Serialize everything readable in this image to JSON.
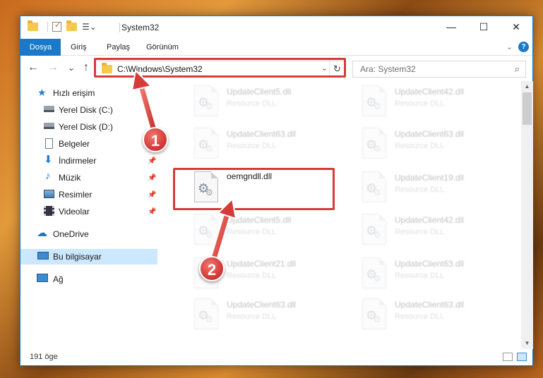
{
  "window": {
    "title": "System32",
    "minimize_glyph": "—",
    "maximize_glyph": "☐",
    "close_glyph": "✕"
  },
  "ribbon": {
    "tabs": [
      "Dosya",
      "Giriş",
      "Paylaş",
      "Görünüm"
    ],
    "help_glyph": "?",
    "accent_color": "#1979ca"
  },
  "nav": {
    "back_glyph": "←",
    "forward_glyph": "→",
    "recent_glyph": "⌄",
    "up_glyph": "↑",
    "address_path": "C:\\Windows\\System32",
    "dropdown_glyph": "⌄",
    "refresh_glyph": "↻",
    "search_placeholder": "Ara: System32",
    "search_icon": "search-icon"
  },
  "sidebar": {
    "items": [
      {
        "label": "Hızlı erişim",
        "icon": "star-icon",
        "pinned": false
      },
      {
        "label": "Yerel Disk (C:)",
        "icon": "drive-icon",
        "pinned": false
      },
      {
        "label": "Yerel Disk (D:)",
        "icon": "drive-icon",
        "pinned": false
      },
      {
        "label": "Belgeler",
        "icon": "documents-icon",
        "pinned": false
      },
      {
        "label": "İndirmeler",
        "icon": "download-icon",
        "pinned": true
      },
      {
        "label": "Müzik",
        "icon": "music-icon",
        "pinned": true
      },
      {
        "label": "Resimler",
        "icon": "pictures-icon",
        "pinned": true
      },
      {
        "label": "Videolar",
        "icon": "videos-icon",
        "pinned": true
      },
      {
        "label": "OneDrive",
        "icon": "cloud-icon",
        "pinned": false
      },
      {
        "label": "Bu bilgisayar",
        "icon": "computer-icon",
        "pinned": false,
        "selected": true
      },
      {
        "label": "Ağ",
        "icon": "network-icon",
        "pinned": false
      }
    ],
    "pin_glyph": "📌"
  },
  "files": {
    "left": [
      {
        "name": "UpdateClient5.dll",
        "type": "Resource DLL",
        "blurred": true
      },
      {
        "name": "UpdateClient63.dll",
        "type": "Resource DLL",
        "blurred": true
      },
      {
        "name": "oemgndll.dll",
        "type": "",
        "blurred": false
      },
      {
        "name": "UpdateClient5.dll",
        "type": "Resource DLL",
        "blurred": true
      },
      {
        "name": "UpdateClient21.dll",
        "type": "Resource DLL",
        "blurred": true
      },
      {
        "name": "UpdateClient63.dll",
        "type": "Resource DLL",
        "blurred": true
      }
    ],
    "right": [
      {
        "name": "UpdateClient42.dll",
        "type": "Resource DLL",
        "blurred": true
      },
      {
        "name": "UpdateClient63.dll",
        "type": "Resource DLL",
        "blurred": true
      },
      {
        "name": "UpdateClient19.dll",
        "type": "Resource DLL",
        "blurred": true
      },
      {
        "name": "UpdateClient42.dll",
        "type": "Resource DLL",
        "blurred": true
      },
      {
        "name": "UpdateClient63.dll",
        "type": "Resource DLL",
        "blurred": true
      },
      {
        "name": "UpdateClient63.dll",
        "type": "Resource DLL",
        "blurred": true
      }
    ]
  },
  "status": {
    "item_count": "191 öge"
  },
  "annotations": {
    "callout_1": "1",
    "callout_2": "2",
    "highlight_color": "#d63b3b"
  }
}
